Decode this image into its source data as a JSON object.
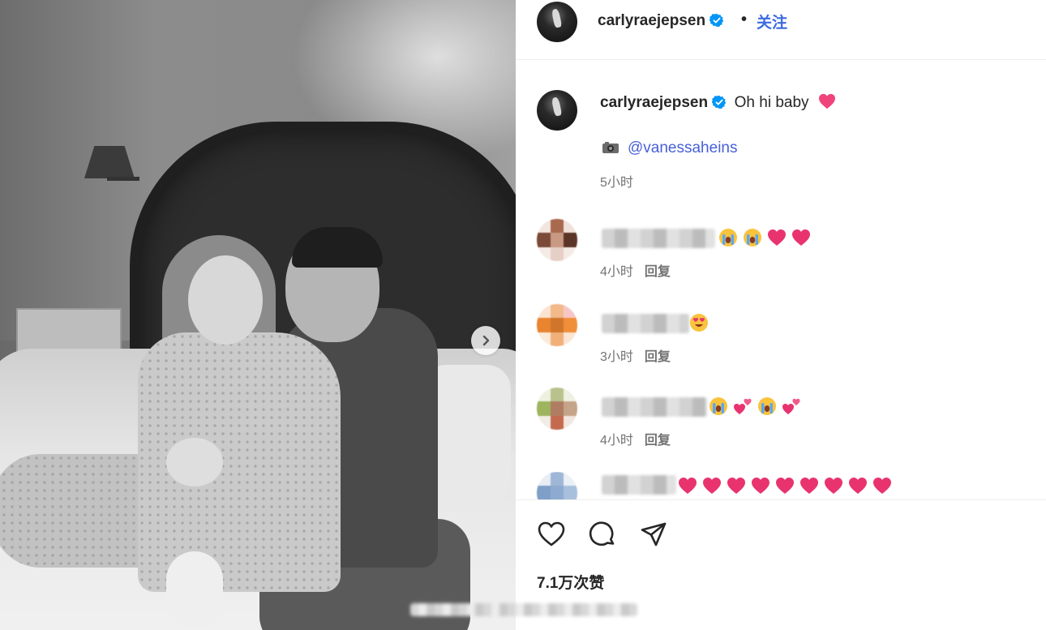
{
  "post": {
    "username": "carlyraejepsen",
    "follow_label": "关注",
    "separator": "•",
    "caption_text": "Oh hi baby",
    "photo_credit": "@vanessaheins",
    "posted_time": "5小时",
    "likes": "7.1万次赞"
  },
  "comments": [
    {
      "time": "4小时",
      "reply_label": "回复",
      "emojis": [
        "loudly-crying-face",
        "loudly-crying-face",
        "red-heart",
        "red-heart"
      ]
    },
    {
      "time": "3小时",
      "reply_label": "回复",
      "emojis": [
        "heart-eyes-face"
      ]
    },
    {
      "time": "4小时",
      "reply_label": "回复",
      "emojis": [
        "loudly-crying-face",
        "two-hearts",
        "loudly-crying-face",
        "two-hearts"
      ]
    },
    {
      "time": "",
      "reply_label": "",
      "emojis": [
        "red-heart",
        "red-heart",
        "red-heart",
        "red-heart",
        "red-heart",
        "red-heart",
        "red-heart",
        "red-heart",
        "red-heart"
      ]
    }
  ],
  "icons": {
    "verified": "verified-badge-icon",
    "next": "chevron-right-icon",
    "like": "heart-outline-icon",
    "comment": "speech-bubble-icon",
    "share": "paper-plane-icon",
    "camera": "camera-icon"
  },
  "colors": {
    "link_blue": "#3d6ae0",
    "verified_blue": "#0095f6",
    "heart_pink": "#e8336f",
    "muted_text": "#737373"
  }
}
